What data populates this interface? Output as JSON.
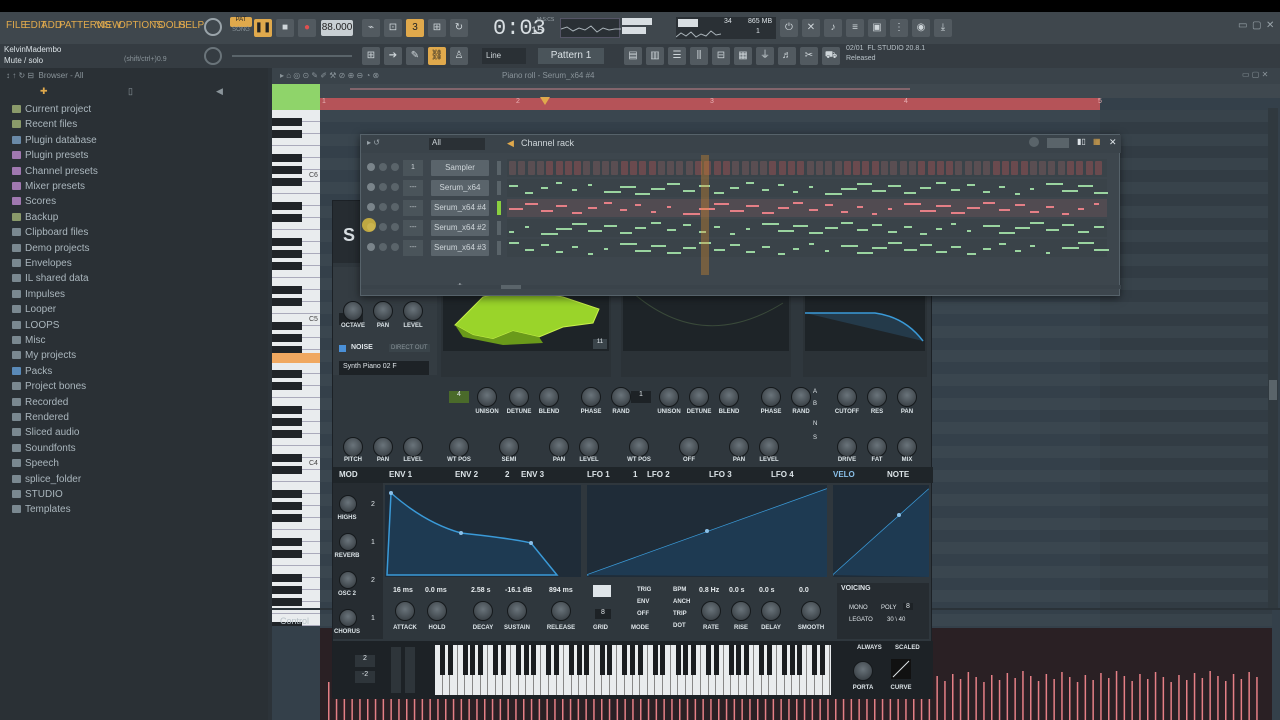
{
  "menu": [
    "FILE",
    "EDIT",
    "ADD",
    "PATTERNS",
    "VIEW",
    "OPTIONS",
    "TOOLS",
    "HELP"
  ],
  "transport": {
    "tempo": "88.000",
    "time": "0:03",
    "time_small": "15",
    "time_unit": "M:S:CS",
    "pat": "PAT",
    "song": "SONG",
    "cpu": "34",
    "ram": "865 MB",
    "voices": "1"
  },
  "hint": {
    "user": "KelvinMadembo",
    "action": "Mute / solo",
    "shortcut": "(shift/ctrl+)0.9"
  },
  "pattern": {
    "snap": "Line",
    "name": "Pattern 1"
  },
  "news": {
    "date": "02/01",
    "title": "FL STUDIO 20.8.1",
    "status": "Released"
  },
  "browser": {
    "title": "Browser - All",
    "items": [
      {
        "label": "Current project",
        "color": "#8a9a6a"
      },
      {
        "label": "Recent files",
        "color": "#8a9a6a"
      },
      {
        "label": "Plugin database",
        "color": "#6a8aa8"
      },
      {
        "label": "Plugin presets",
        "color": "#a078b0"
      },
      {
        "label": "Channel presets",
        "color": "#a078b0"
      },
      {
        "label": "Mixer presets",
        "color": "#a078b0"
      },
      {
        "label": "Scores",
        "color": "#a078b0"
      },
      {
        "label": "Backup",
        "color": "#8a9a6a"
      },
      {
        "label": "Clipboard files",
        "color": "#7a8890"
      },
      {
        "label": "Demo projects",
        "color": "#7a8890"
      },
      {
        "label": "Envelopes",
        "color": "#7a8890"
      },
      {
        "label": "IL shared data",
        "color": "#7a8890"
      },
      {
        "label": "Impulses",
        "color": "#7a8890"
      },
      {
        "label": "Looper",
        "color": "#7a8890"
      },
      {
        "label": "LOOPS",
        "color": "#7a8890"
      },
      {
        "label": "Misc",
        "color": "#7a8890"
      },
      {
        "label": "My projects",
        "color": "#7a8890"
      },
      {
        "label": "Packs",
        "color": "#5a8ab8"
      },
      {
        "label": "Project bones",
        "color": "#7a8890"
      },
      {
        "label": "Recorded",
        "color": "#7a8890"
      },
      {
        "label": "Rendered",
        "color": "#7a8890"
      },
      {
        "label": "Sliced audio",
        "color": "#7a8890"
      },
      {
        "label": "Soundfonts",
        "color": "#7a8890"
      },
      {
        "label": "Speech",
        "color": "#7a8890"
      },
      {
        "label": "splice_folder",
        "color": "#7a8890"
      },
      {
        "label": "STUDIO",
        "color": "#7a8890"
      },
      {
        "label": "Templates",
        "color": "#7a8890"
      }
    ]
  },
  "pianoroll": {
    "title": "Piano roll - Serum_x64 #4",
    "bars": [
      "1",
      "2",
      "3",
      "4",
      "5"
    ],
    "octaves": [
      "C6",
      "C5",
      "C4"
    ],
    "control": "Control"
  },
  "rack": {
    "title": "Channel rack",
    "filter": "All",
    "channels": [
      {
        "name": "Sampler",
        "num": "1"
      },
      {
        "name": "Serum_x64",
        "num": "---"
      },
      {
        "name": "Serum_x64 #4",
        "num": "---"
      },
      {
        "name": "Serum_x64 #2",
        "num": "---"
      },
      {
        "name": "Serum_x64 #3",
        "num": "---"
      }
    ],
    "add": "+"
  },
  "serum": {
    "osc_labels": [
      "OCTAVE",
      "PAN",
      "LEVEL",
      "UNISON",
      "DETUNE",
      "BLEND",
      "PHASE",
      "RAND",
      "UNISON",
      "DETUNE",
      "BLEND",
      "PHASE",
      "RAND",
      "CUTOFF",
      "RES",
      "PAN"
    ],
    "osc_labels2": [
      "PITCH",
      "PAN",
      "LEVEL",
      "WT POS",
      "SEMI",
      "PAN",
      "LEVEL",
      "WT POS",
      "OFF",
      "PAN",
      "LEVEL",
      "DRIVE",
      "FAT",
      "MIX"
    ],
    "noise": "NOISE",
    "direct_out": "DIRECT OUT",
    "noise_preset": "Synth Piano 02 F",
    "wt_frame": "11",
    "unison_a": "4",
    "unison_b": "1",
    "octave": "0",
    "filter_opts": [
      "A",
      "B",
      "N",
      "S"
    ],
    "mod_tabs": [
      "MOD",
      "ENV 1",
      "ENV 2",
      "2",
      "ENV 3",
      "LFO 1",
      "1",
      "LFO 2",
      "LFO 3",
      "LFO 4",
      "VELO",
      "NOTE"
    ],
    "mod_labels": [
      "HIGHS",
      "REVERB",
      "OSC 2",
      "CHORUS"
    ],
    "mod_counts": [
      "2",
      "1",
      "2",
      "1"
    ],
    "env_values": [
      "16 ms",
      "0.0 ms",
      "2.58 s",
      "-16.1 dB",
      "894 ms"
    ],
    "env_labels": [
      "ATTACK",
      "HOLD",
      "DECAY",
      "SUSTAIN",
      "RELEASE"
    ],
    "lfo_values": [
      "0.8 Hz",
      "0.0 s",
      "0.0 s",
      "0.0"
    ],
    "lfo_labels": [
      "RATE",
      "RISE",
      "DELAY",
      "SMOOTH"
    ],
    "lfo_modes": [
      "TRIG",
      "ENV",
      "OFF"
    ],
    "lfo_modes2": [
      "BPM",
      "ANCH",
      "TRIP",
      "DOT"
    ],
    "grid": "GRID",
    "grid_val": "8",
    "mode": "MODE",
    "voicing": {
      "title": "VOICING",
      "mono": "MONO",
      "poly": "POLY",
      "poly_val": "8",
      "legato": "LEGATO",
      "legato_val": "30 \\ 40",
      "always": "ALWAYS",
      "scaled": "SCALED",
      "porta": "PORTA",
      "curve": "CURVE"
    },
    "pitch_up": "2",
    "pitch_down": "-2",
    "logo": "S"
  }
}
